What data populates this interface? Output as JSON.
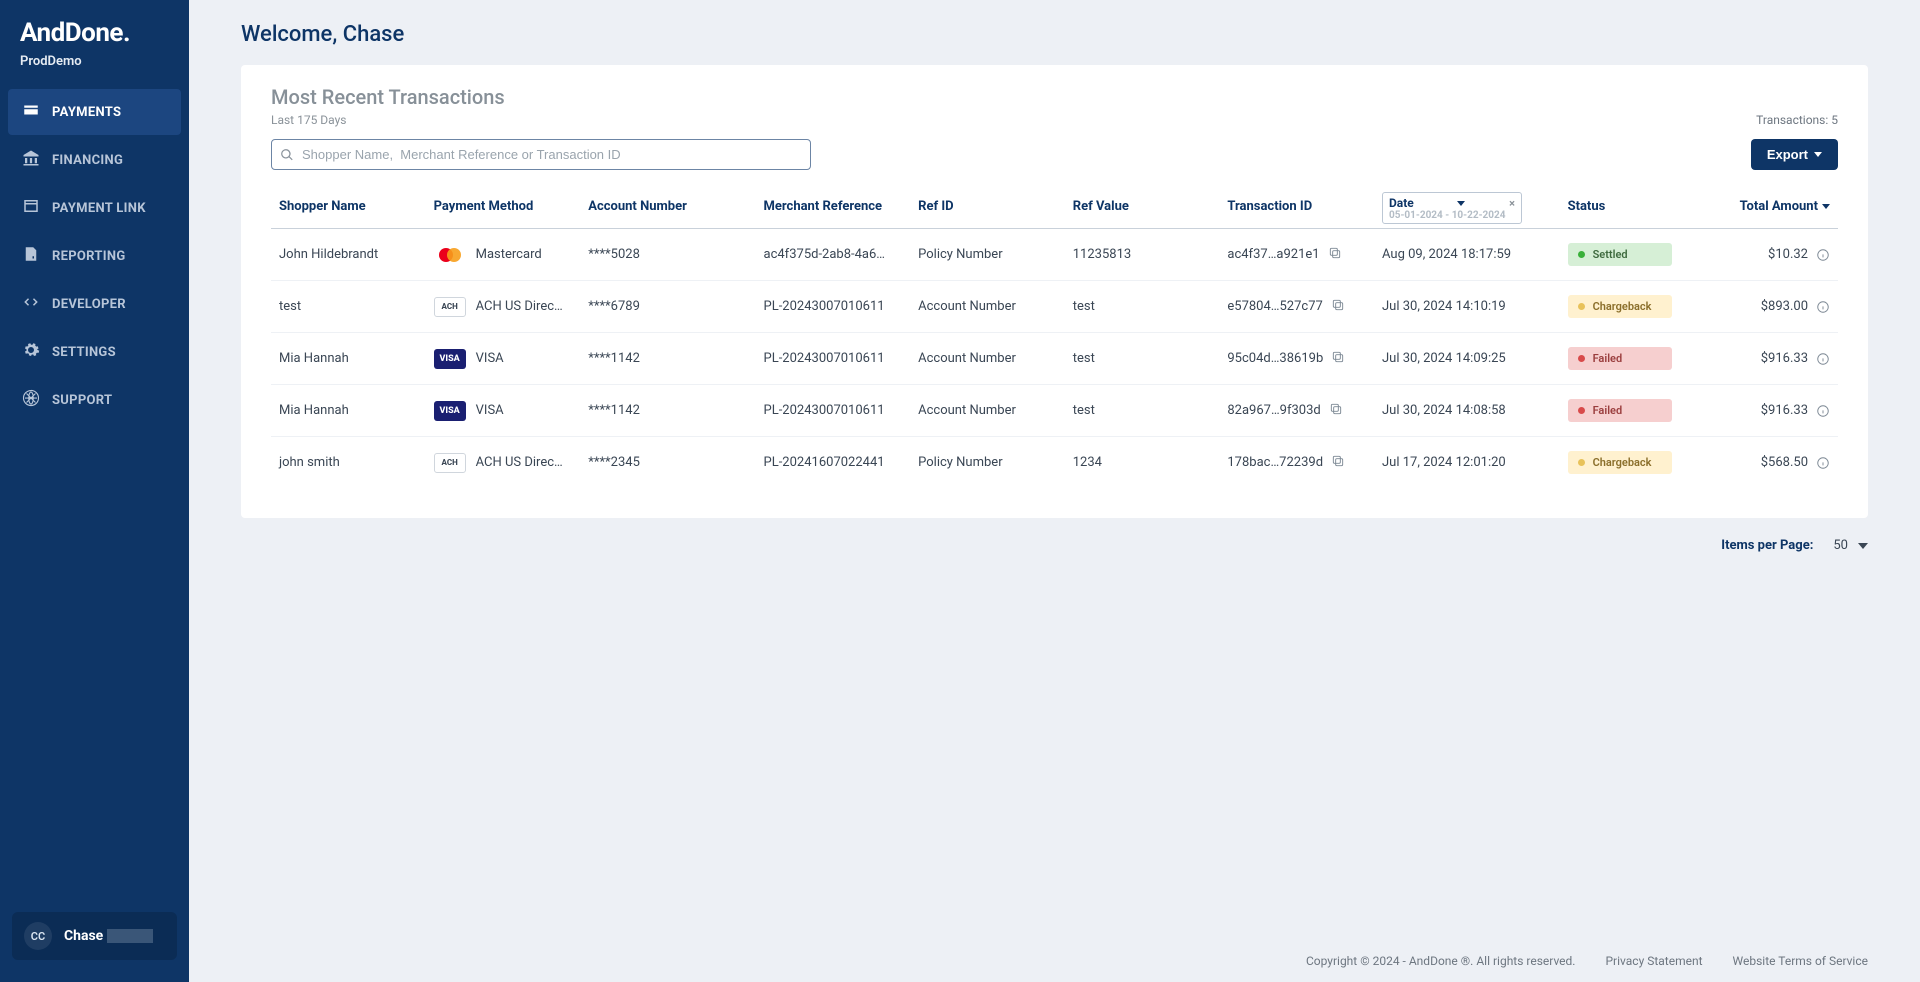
{
  "brand": "AndDone.",
  "env": "ProdDemo",
  "nav": [
    {
      "label": "PAYMENTS",
      "icon": "payments",
      "active": true
    },
    {
      "label": "FINANCING",
      "icon": "bank",
      "active": false
    },
    {
      "label": "PAYMENT LINK",
      "icon": "link",
      "active": false
    },
    {
      "label": "REPORTING",
      "icon": "report",
      "active": false
    },
    {
      "label": "DEVELOPER",
      "icon": "code",
      "active": false
    },
    {
      "label": "SETTINGS",
      "icon": "gear",
      "active": false
    },
    {
      "label": "SUPPORT",
      "icon": "globe",
      "active": false
    }
  ],
  "user": {
    "initials": "CC",
    "name": "Chase"
  },
  "welcome": "Welcome, Chase",
  "card": {
    "title": "Most Recent Transactions",
    "sub": "Last 175 Days",
    "tx_count_label": "Transactions: 5",
    "search_placeholder": "Shopper Name,  Merchant Reference or Transaction ID",
    "export_label": "Export",
    "date_filter": {
      "label": "Date",
      "range": "05-01-2024 - 10-22-2024"
    }
  },
  "columns": {
    "shopper": "Shopper Name",
    "pm": "Payment Method",
    "acct": "Account Number",
    "merch": "Merchant Reference",
    "refid": "Ref ID",
    "refval": "Ref Value",
    "txid": "Transaction ID",
    "date": "Date",
    "status": "Status",
    "total": "Total Amount"
  },
  "rows": [
    {
      "shopper": "John Hildebrandt",
      "pm_type": "mc",
      "pm_label": "Mastercard",
      "acct": "****5028",
      "merch": "ac4f375d-2ab8-4a6…",
      "refid": "Policy Number",
      "refval": "11235813",
      "txid": "ac4f37…a921e1",
      "date": "Aug 09, 2024 18:17:59",
      "status": "Settled",
      "status_class": "b-settled",
      "amount": "$10.32"
    },
    {
      "shopper": "test",
      "pm_type": "ach",
      "pm_label": "ACH US Direc…",
      "acct": "****6789",
      "merch": "PL-20243007010611",
      "refid": "Account Number",
      "refval": "test",
      "txid": "e57804…527c77",
      "date": "Jul 30, 2024 14:10:19",
      "status": "Chargeback",
      "status_class": "b-charge",
      "amount": "$893.00"
    },
    {
      "shopper": "Mia Hannah",
      "pm_type": "visa",
      "pm_label": "VISA",
      "acct": "****1142",
      "merch": "PL-20243007010611",
      "refid": "Account Number",
      "refval": "test",
      "txid": "95c04d…38619b",
      "date": "Jul 30, 2024 14:09:25",
      "status": "Failed",
      "status_class": "b-failed",
      "amount": "$916.33"
    },
    {
      "shopper": "Mia Hannah",
      "pm_type": "visa",
      "pm_label": "VISA",
      "acct": "****1142",
      "merch": "PL-20243007010611",
      "refid": "Account Number",
      "refval": "test",
      "txid": "82a967…9f303d",
      "date": "Jul 30, 2024 14:08:58",
      "status": "Failed",
      "status_class": "b-failed",
      "amount": "$916.33"
    },
    {
      "shopper": "john smith",
      "pm_type": "ach",
      "pm_label": "ACH US Direc…",
      "acct": "****2345",
      "merch": "PL-20241607022441",
      "refid": "Policy Number",
      "refval": "1234",
      "txid": "178bac…72239d",
      "date": "Jul 17, 2024 12:01:20",
      "status": "Chargeback",
      "status_class": "b-charge",
      "amount": "$568.50"
    }
  ],
  "pager": {
    "label": "Items per Page:",
    "value": "50"
  },
  "footer": {
    "copyright": "Copyright © 2024 - AndDone ®. All rights reserved.",
    "privacy": "Privacy Statement",
    "terms": "Website Terms of Service"
  }
}
